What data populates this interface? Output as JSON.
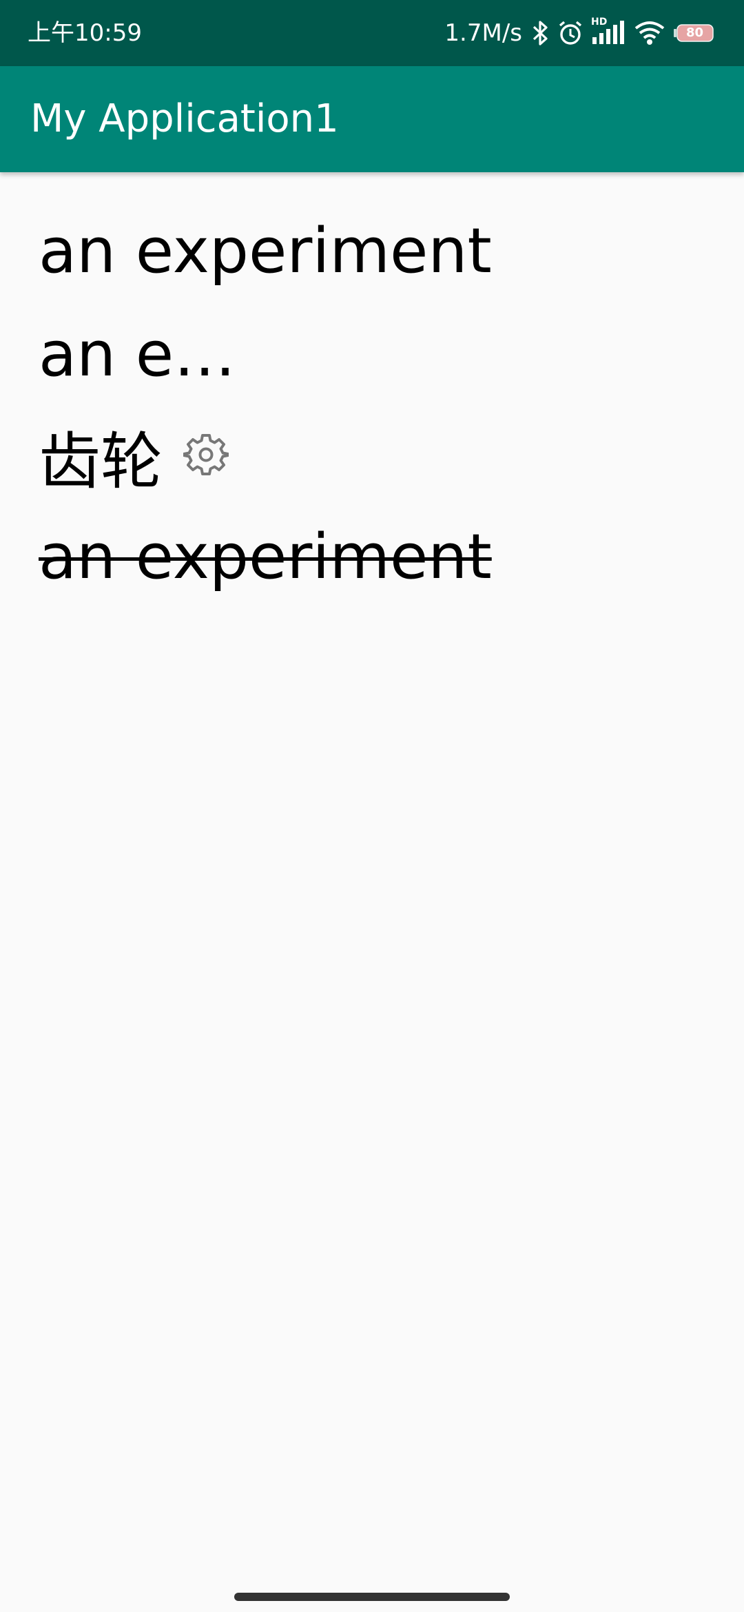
{
  "status_bar": {
    "time": "上午10:59",
    "net_speed": "1.7M/s",
    "hd_label": "HD",
    "battery_level": "80",
    "icons": [
      "bluetooth-icon",
      "alarm-icon",
      "signal-icon",
      "wifi-icon",
      "battery-icon"
    ]
  },
  "app_bar": {
    "title": "My Application1",
    "color": "#008577"
  },
  "main": {
    "lines": [
      {
        "text": "an experiment",
        "style": "normal"
      },
      {
        "text": "an e…",
        "style": "ellipsized"
      },
      {
        "text": "齿轮",
        "style": "normal",
        "trailing_icon": "gear-icon"
      },
      {
        "text": "an experiment",
        "style": "strikethrough"
      }
    ]
  },
  "colors": {
    "status_bar": "#00574b",
    "app_bar": "#008577",
    "background": "#fafafa",
    "text": "#000000"
  }
}
